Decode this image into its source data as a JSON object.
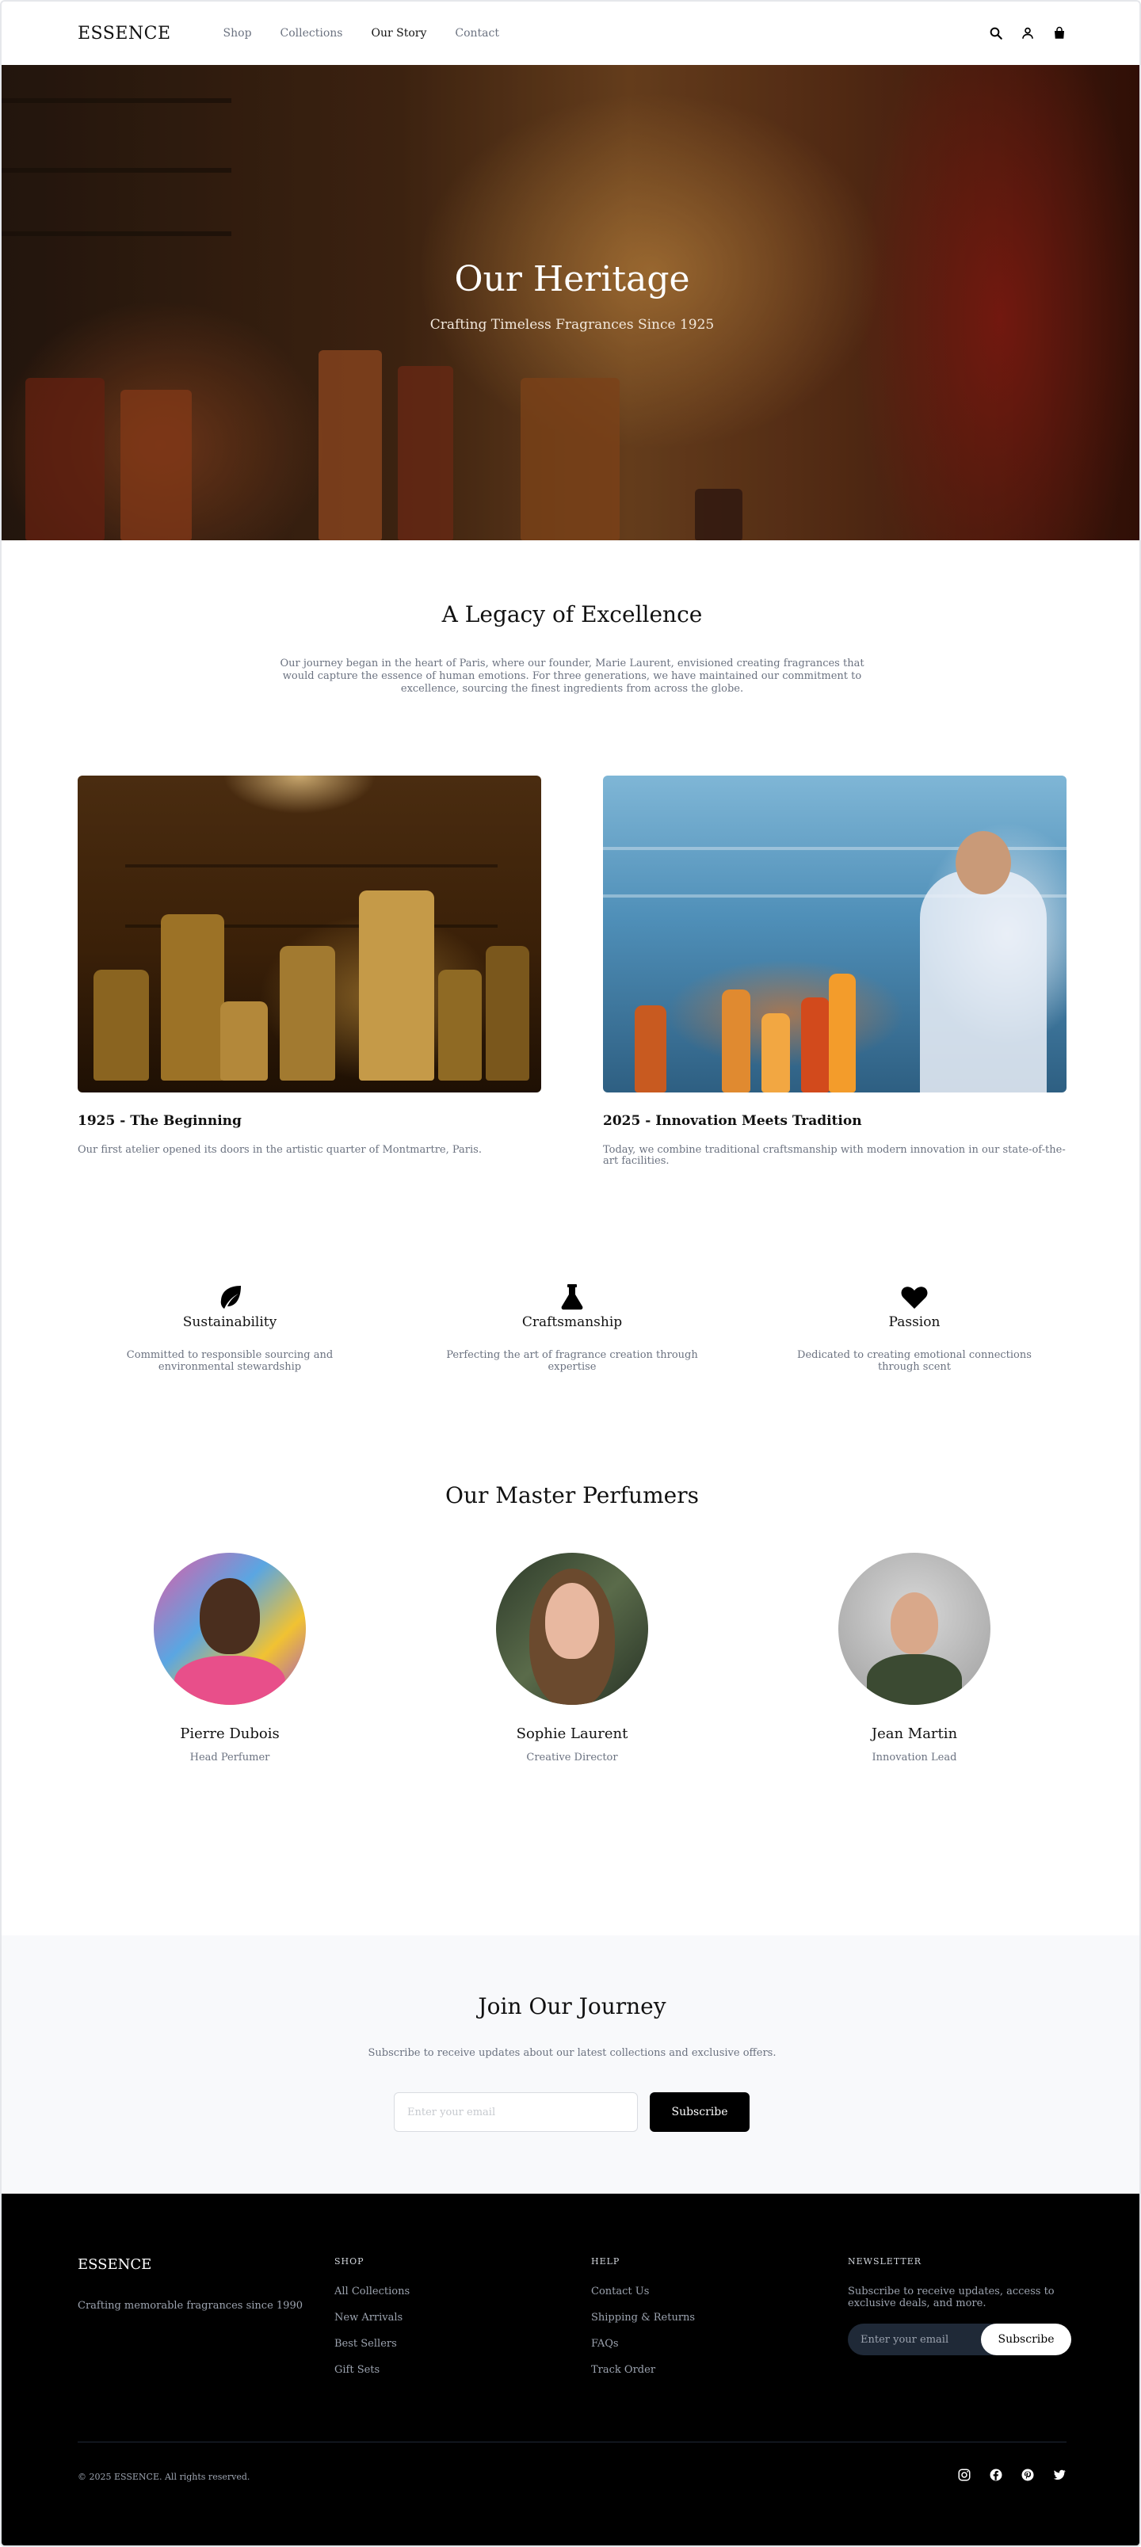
{
  "nav": {
    "brand": "ESSENCE",
    "links": [
      "Shop",
      "Collections",
      "Our Story",
      "Contact"
    ],
    "active": "Our Story",
    "icons": [
      "search-icon",
      "user-icon",
      "shopping-bag-icon"
    ]
  },
  "hero": {
    "title": "Our Heritage",
    "subtitle": "Crafting Timeless Fragrances Since 1925"
  },
  "legacy": {
    "title": "A Legacy of Excellence",
    "text": "Our journey began in the heart of Paris, where our founder, Marie Laurent, envisioned creating fragrances that would capture the essence of human emotions. For three generations, we have maintained our commitment to excellence, sourcing the finest ingredients from across the globe."
  },
  "timeline": [
    {
      "title": "1925 - The Beginning",
      "text": "Our first atelier opened its doors in the artistic quarter of Montmartre, Paris."
    },
    {
      "title": "2025 - Innovation Meets Tradition",
      "text": "Today, we combine traditional craftsmanship with modern innovation in our state-of-the-art facilities."
    }
  ],
  "values": [
    {
      "icon": "leaf-icon",
      "title": "Sustainability",
      "text": "Committed to responsible sourcing and environmental stewardship"
    },
    {
      "icon": "flask-icon",
      "title": "Craftsmanship",
      "text": "Perfecting the art of fragrance creation through expertise"
    },
    {
      "icon": "heart-icon",
      "title": "Passion",
      "text": "Dedicated to creating emotional connections through scent"
    }
  ],
  "perfumers": {
    "title": "Our Master Perfumers",
    "people": [
      {
        "name": "Pierre Dubois",
        "role": "Head Perfumer"
      },
      {
        "name": "Sophie Laurent",
        "role": "Creative Director"
      },
      {
        "name": "Jean Martin",
        "role": "Innovation Lead"
      }
    ]
  },
  "newsletter": {
    "title": "Join Our Journey",
    "subtitle": "Subscribe to receive updates about our latest collections and exclusive offers.",
    "placeholder": "Enter your email",
    "button": "Subscribe"
  },
  "footer": {
    "brand": "ESSENCE",
    "tagline": "Crafting memorable fragrances since 1990",
    "shop": {
      "heading": "SHOP",
      "links": [
        "All Collections",
        "New Arrivals",
        "Best Sellers",
        "Gift Sets"
      ]
    },
    "help": {
      "heading": "HELP",
      "links": [
        "Contact Us",
        "Shipping & Returns",
        "FAQs",
        "Track Order"
      ]
    },
    "newsletter": {
      "heading": "NEWSLETTER",
      "text": "Subscribe to receive updates, access to exclusive deals, and more.",
      "placeholder": "Enter your email",
      "button": "Subscribe"
    },
    "copyright": "© 2025 ESSENCE. All rights reserved.",
    "social": [
      "instagram-icon",
      "facebook-icon",
      "pinterest-icon",
      "twitter-icon"
    ]
  }
}
